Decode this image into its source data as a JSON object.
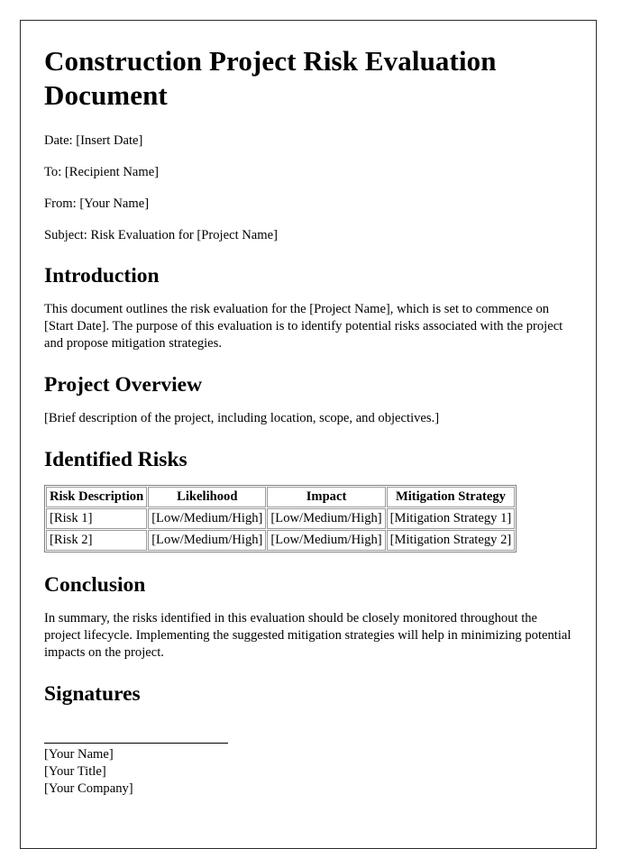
{
  "document": {
    "title": "Construction Project Risk Evaluation Document",
    "meta": [
      "Date: [Insert Date]",
      "To: [Recipient Name]",
      "From: [Your Name]",
      "Subject: Risk Evaluation for [Project Name]"
    ],
    "sections": {
      "introduction": {
        "heading": "Introduction",
        "body": "This document outlines the risk evaluation for the [Project Name], which is set to commence on [Start Date]. The purpose of this evaluation is to identify potential risks associated with the project and propose mitigation strategies."
      },
      "project_overview": {
        "heading": "Project Overview",
        "body": "[Brief description of the project, including location, scope, and objectives.]"
      },
      "identified_risks": {
        "heading": "Identified Risks",
        "table": {
          "columns": [
            "Risk Description",
            "Likelihood",
            "Impact",
            "Mitigation Strategy"
          ],
          "rows": [
            [
              "[Risk 1]",
              "[Low/Medium/High]",
              "[Low/Medium/High]",
              "[Mitigation Strategy 1]"
            ],
            [
              "[Risk 2]",
              "[Low/Medium/High]",
              "[Low/Medium/High]",
              "[Mitigation Strategy 2]"
            ]
          ]
        }
      },
      "conclusion": {
        "heading": "Conclusion",
        "body": "In summary, the risks identified in this evaluation should be closely monitored throughout the project lifecycle. Implementing the suggested mitigation strategies will help in minimizing potential impacts on the project."
      },
      "signatures": {
        "heading": "Signatures",
        "lines": [
          "[Your Name]",
          "[Your Title]",
          "[Your Company]"
        ]
      }
    }
  }
}
